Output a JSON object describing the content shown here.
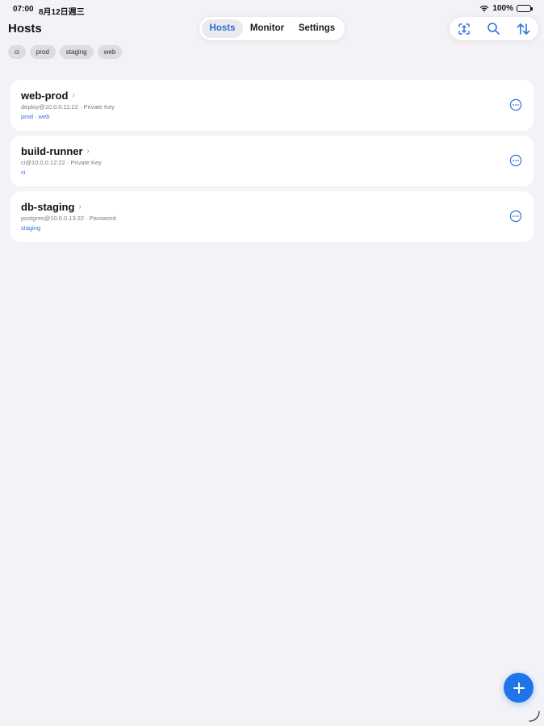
{
  "status": {
    "time": "07:00",
    "date": "8月12日週三",
    "battery": "100%",
    "icons": [
      "wifi-icon",
      "battery-icon"
    ]
  },
  "header": {
    "title": "Hosts"
  },
  "tabs": [
    {
      "label": "Hosts",
      "active": true
    },
    {
      "label": "Monitor",
      "active": false
    },
    {
      "label": "Settings",
      "active": false
    }
  ],
  "toolbar": {
    "icons": [
      "select-icon",
      "search-icon",
      "sort-icon"
    ]
  },
  "filters": [
    "ci",
    "prod",
    "staging",
    "web"
  ],
  "hosts": [
    {
      "name": "web-prod",
      "address": "deploy@10.0.0.11:22",
      "auth": "Private Key",
      "tags": "prod · web"
    },
    {
      "name": "build-runner",
      "address": "ci@10.0.0.12:22",
      "auth": "Private Key",
      "tags": "ci"
    },
    {
      "name": "db-staging",
      "address": "postgres@10.0.0.13:22",
      "auth": "Password",
      "tags": "staging"
    }
  ],
  "colors": {
    "accent": "#2f74db",
    "background": "#f2f2f7",
    "fab": "#1f74e8"
  }
}
